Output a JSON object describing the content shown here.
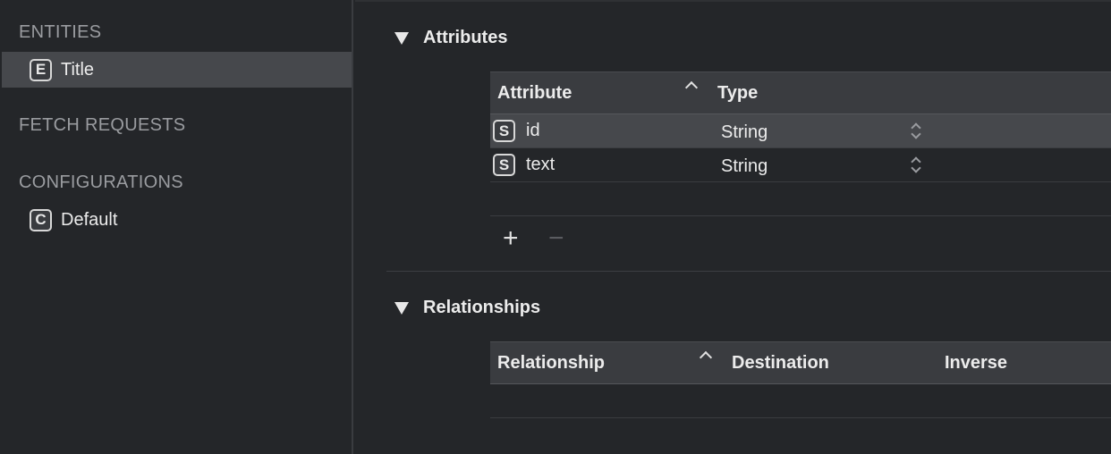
{
  "sidebar": {
    "entities_header": "ENTITIES",
    "entities": [
      {
        "badge": "E",
        "label": "Title"
      }
    ],
    "fetch_requests_header": "FETCH REQUESTS",
    "configurations_header": "CONFIGURATIONS",
    "configurations": [
      {
        "badge": "C",
        "label": "Default"
      }
    ]
  },
  "attributes": {
    "title": "Attributes",
    "columns": {
      "attribute": "Attribute",
      "type": "Type"
    },
    "rows": [
      {
        "badge": "S",
        "name": "id",
        "type": "String"
      },
      {
        "badge": "S",
        "name": "text",
        "type": "String"
      }
    ],
    "add_label": "+",
    "remove_label": "−"
  },
  "relationships": {
    "title": "Relationships",
    "columns": {
      "relationship": "Relationship",
      "destination": "Destination",
      "inverse": "Inverse"
    }
  },
  "colors": {
    "background": "#242629",
    "selection": "#46484c",
    "header": "#3a3c40"
  },
  "icons": [
    "disclosure-triangle-icon",
    "sort-ascending-icon",
    "stepper-icon"
  ]
}
